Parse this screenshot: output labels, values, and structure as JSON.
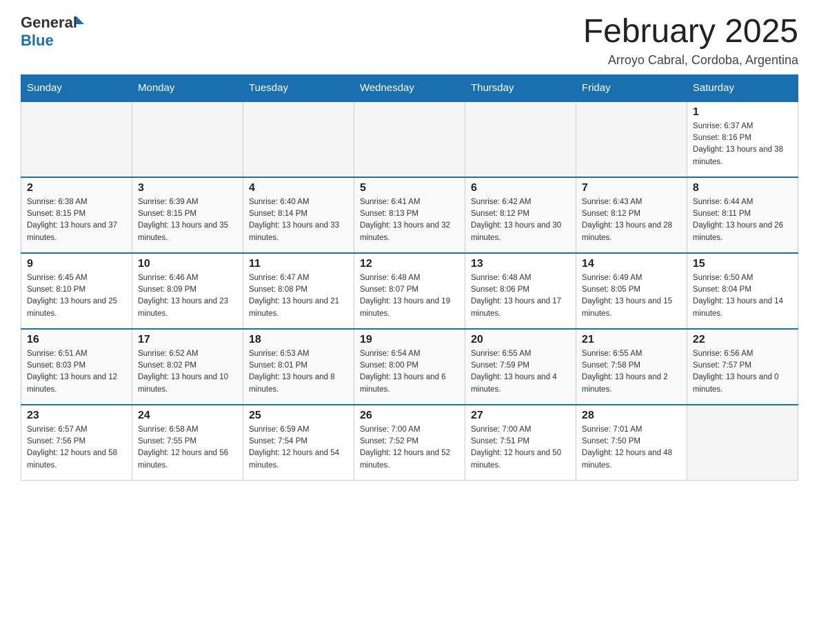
{
  "header": {
    "logo_general": "General",
    "logo_blue": "Blue",
    "month_title": "February 2025",
    "subtitle": "Arroyo Cabral, Cordoba, Argentina"
  },
  "days_of_week": [
    "Sunday",
    "Monday",
    "Tuesday",
    "Wednesday",
    "Thursday",
    "Friday",
    "Saturday"
  ],
  "weeks": [
    [
      {
        "day": "",
        "sunrise": "",
        "sunset": "",
        "daylight": ""
      },
      {
        "day": "",
        "sunrise": "",
        "sunset": "",
        "daylight": ""
      },
      {
        "day": "",
        "sunrise": "",
        "sunset": "",
        "daylight": ""
      },
      {
        "day": "",
        "sunrise": "",
        "sunset": "",
        "daylight": ""
      },
      {
        "day": "",
        "sunrise": "",
        "sunset": "",
        "daylight": ""
      },
      {
        "day": "",
        "sunrise": "",
        "sunset": "",
        "daylight": ""
      },
      {
        "day": "1",
        "sunrise": "Sunrise: 6:37 AM",
        "sunset": "Sunset: 8:16 PM",
        "daylight": "Daylight: 13 hours and 38 minutes."
      }
    ],
    [
      {
        "day": "2",
        "sunrise": "Sunrise: 6:38 AM",
        "sunset": "Sunset: 8:15 PM",
        "daylight": "Daylight: 13 hours and 37 minutes."
      },
      {
        "day": "3",
        "sunrise": "Sunrise: 6:39 AM",
        "sunset": "Sunset: 8:15 PM",
        "daylight": "Daylight: 13 hours and 35 minutes."
      },
      {
        "day": "4",
        "sunrise": "Sunrise: 6:40 AM",
        "sunset": "Sunset: 8:14 PM",
        "daylight": "Daylight: 13 hours and 33 minutes."
      },
      {
        "day": "5",
        "sunrise": "Sunrise: 6:41 AM",
        "sunset": "Sunset: 8:13 PM",
        "daylight": "Daylight: 13 hours and 32 minutes."
      },
      {
        "day": "6",
        "sunrise": "Sunrise: 6:42 AM",
        "sunset": "Sunset: 8:12 PM",
        "daylight": "Daylight: 13 hours and 30 minutes."
      },
      {
        "day": "7",
        "sunrise": "Sunrise: 6:43 AM",
        "sunset": "Sunset: 8:12 PM",
        "daylight": "Daylight: 13 hours and 28 minutes."
      },
      {
        "day": "8",
        "sunrise": "Sunrise: 6:44 AM",
        "sunset": "Sunset: 8:11 PM",
        "daylight": "Daylight: 13 hours and 26 minutes."
      }
    ],
    [
      {
        "day": "9",
        "sunrise": "Sunrise: 6:45 AM",
        "sunset": "Sunset: 8:10 PM",
        "daylight": "Daylight: 13 hours and 25 minutes."
      },
      {
        "day": "10",
        "sunrise": "Sunrise: 6:46 AM",
        "sunset": "Sunset: 8:09 PM",
        "daylight": "Daylight: 13 hours and 23 minutes."
      },
      {
        "day": "11",
        "sunrise": "Sunrise: 6:47 AM",
        "sunset": "Sunset: 8:08 PM",
        "daylight": "Daylight: 13 hours and 21 minutes."
      },
      {
        "day": "12",
        "sunrise": "Sunrise: 6:48 AM",
        "sunset": "Sunset: 8:07 PM",
        "daylight": "Daylight: 13 hours and 19 minutes."
      },
      {
        "day": "13",
        "sunrise": "Sunrise: 6:48 AM",
        "sunset": "Sunset: 8:06 PM",
        "daylight": "Daylight: 13 hours and 17 minutes."
      },
      {
        "day": "14",
        "sunrise": "Sunrise: 6:49 AM",
        "sunset": "Sunset: 8:05 PM",
        "daylight": "Daylight: 13 hours and 15 minutes."
      },
      {
        "day": "15",
        "sunrise": "Sunrise: 6:50 AM",
        "sunset": "Sunset: 8:04 PM",
        "daylight": "Daylight: 13 hours and 14 minutes."
      }
    ],
    [
      {
        "day": "16",
        "sunrise": "Sunrise: 6:51 AM",
        "sunset": "Sunset: 8:03 PM",
        "daylight": "Daylight: 13 hours and 12 minutes."
      },
      {
        "day": "17",
        "sunrise": "Sunrise: 6:52 AM",
        "sunset": "Sunset: 8:02 PM",
        "daylight": "Daylight: 13 hours and 10 minutes."
      },
      {
        "day": "18",
        "sunrise": "Sunrise: 6:53 AM",
        "sunset": "Sunset: 8:01 PM",
        "daylight": "Daylight: 13 hours and 8 minutes."
      },
      {
        "day": "19",
        "sunrise": "Sunrise: 6:54 AM",
        "sunset": "Sunset: 8:00 PM",
        "daylight": "Daylight: 13 hours and 6 minutes."
      },
      {
        "day": "20",
        "sunrise": "Sunrise: 6:55 AM",
        "sunset": "Sunset: 7:59 PM",
        "daylight": "Daylight: 13 hours and 4 minutes."
      },
      {
        "day": "21",
        "sunrise": "Sunrise: 6:55 AM",
        "sunset": "Sunset: 7:58 PM",
        "daylight": "Daylight: 13 hours and 2 minutes."
      },
      {
        "day": "22",
        "sunrise": "Sunrise: 6:56 AM",
        "sunset": "Sunset: 7:57 PM",
        "daylight": "Daylight: 13 hours and 0 minutes."
      }
    ],
    [
      {
        "day": "23",
        "sunrise": "Sunrise: 6:57 AM",
        "sunset": "Sunset: 7:56 PM",
        "daylight": "Daylight: 12 hours and 58 minutes."
      },
      {
        "day": "24",
        "sunrise": "Sunrise: 6:58 AM",
        "sunset": "Sunset: 7:55 PM",
        "daylight": "Daylight: 12 hours and 56 minutes."
      },
      {
        "day": "25",
        "sunrise": "Sunrise: 6:59 AM",
        "sunset": "Sunset: 7:54 PM",
        "daylight": "Daylight: 12 hours and 54 minutes."
      },
      {
        "day": "26",
        "sunrise": "Sunrise: 7:00 AM",
        "sunset": "Sunset: 7:52 PM",
        "daylight": "Daylight: 12 hours and 52 minutes."
      },
      {
        "day": "27",
        "sunrise": "Sunrise: 7:00 AM",
        "sunset": "Sunset: 7:51 PM",
        "daylight": "Daylight: 12 hours and 50 minutes."
      },
      {
        "day": "28",
        "sunrise": "Sunrise: 7:01 AM",
        "sunset": "Sunset: 7:50 PM",
        "daylight": "Daylight: 12 hours and 48 minutes."
      },
      {
        "day": "",
        "sunrise": "",
        "sunset": "",
        "daylight": ""
      }
    ]
  ]
}
